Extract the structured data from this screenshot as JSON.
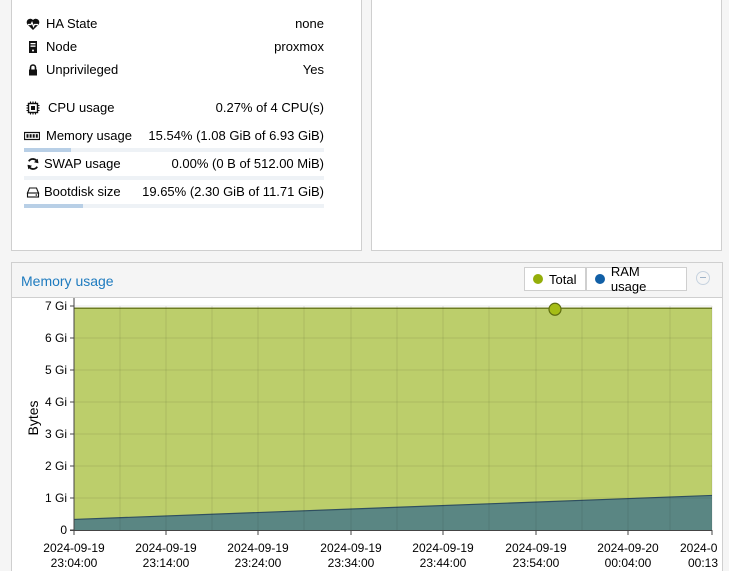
{
  "status": {
    "rows": [
      {
        "name": "ha-state",
        "icon": "heartbeat-icon",
        "label": "HA State",
        "value": "none"
      },
      {
        "name": "node",
        "icon": "server-icon",
        "label": "Node",
        "value": "proxmox"
      },
      {
        "name": "unprivileged",
        "icon": "lock-icon",
        "label": "Unprivileged",
        "value": "Yes"
      },
      {
        "name": "cpu",
        "icon": "cpu-icon",
        "label": "CPU usage",
        "value": "0.27% of 4 CPU(s)",
        "usage": 0.0027
      },
      {
        "name": "memory",
        "icon": "memory-icon",
        "label": "Memory usage",
        "value": "15.54% (1.08 GiB of 6.93 GiB)",
        "usage": 0.1554
      },
      {
        "name": "swap",
        "icon": "refresh-icon",
        "label": "SWAP usage",
        "value": "0.00% (0 B of 512.00 MiB)",
        "usage": 0.0
      },
      {
        "name": "bootdisk",
        "icon": "hdd-icon",
        "label": "Bootdisk size",
        "value": "19.65% (2.30 GiB of 11.71 GiB)",
        "usage": 0.1965
      }
    ]
  },
  "chart_panel": {
    "title": "Memory usage",
    "legend": [
      {
        "label": "Total",
        "color": "#94ae0a"
      },
      {
        "label": "RAM usage",
        "color": "#115fa6"
      }
    ]
  },
  "chart_data": {
    "type": "area",
    "ylabel": "Bytes",
    "yticks": [
      "0",
      "1 Gi",
      "2 Gi",
      "3 Gi",
      "4 Gi",
      "5 Gi",
      "6 Gi",
      "7 Gi"
    ],
    "ylim_gib": [
      0,
      7
    ],
    "x_tick_labels": [
      {
        "date": "2024-09-19",
        "time": "23:04:00"
      },
      {
        "date": "2024-09-19",
        "time": "23:14:00"
      },
      {
        "date": "2024-09-19",
        "time": "23:24:00"
      },
      {
        "date": "2024-09-19",
        "time": "23:34:00"
      },
      {
        "date": "2024-09-19",
        "time": "23:44:00"
      },
      {
        "date": "2024-09-19",
        "time": "23:54:00"
      },
      {
        "date": "2024-09-20",
        "time": "00:04:00"
      },
      {
        "date": "2024-0",
        "time": "00:13"
      }
    ],
    "series": [
      {
        "name": "Total",
        "color": "#94ae0a",
        "values_gib": [
          6.93,
          6.93
        ]
      },
      {
        "name": "RAM usage",
        "color": "#115fa6",
        "values_gib": [
          0.33,
          1.08
        ]
      }
    ],
    "highlight": {
      "series": "Total",
      "time": "2024-09-19 23:59",
      "value_gib": 6.93
    },
    "grid": true
  }
}
